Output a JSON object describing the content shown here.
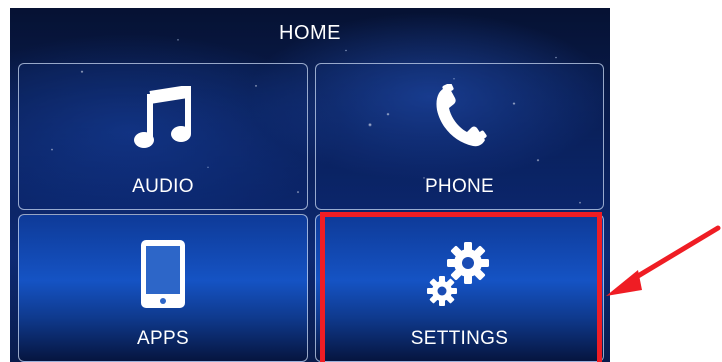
{
  "header": {
    "title": "HOME"
  },
  "tiles": [
    {
      "label": "AUDIO",
      "icon": "music-note-icon"
    },
    {
      "label": "PHONE",
      "icon": "phone-icon"
    },
    {
      "label": "APPS",
      "icon": "tablet-icon"
    },
    {
      "label": "SETTINGS",
      "icon": "gears-icon"
    }
  ],
  "annotation": {
    "highlighted_tile": "SETTINGS",
    "highlight_color": "#ef1d24",
    "arrow_color": "#ef1d24"
  }
}
